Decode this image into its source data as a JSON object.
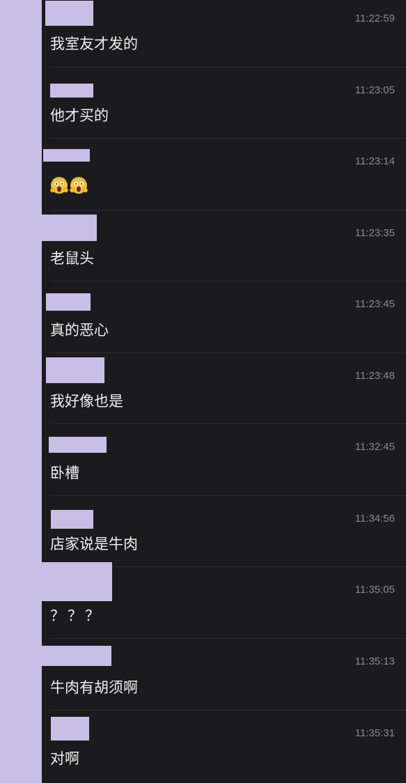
{
  "colors": {
    "background": "#1b1b1d",
    "redaction": "#c8bfe7",
    "text": "#f0f0f0",
    "timestamp": "#8a8a8f"
  },
  "messages": [
    {
      "time": "11:22:59",
      "text": "我室友才发的"
    },
    {
      "time": "11:23:05",
      "text": "他才买的"
    },
    {
      "time": "11:23:14",
      "text": "",
      "emoji": [
        "screaming-face-icon",
        "screaming-face-icon"
      ]
    },
    {
      "time": "11:23:35",
      "text": "老鼠头"
    },
    {
      "time": "11:23:45",
      "text": "真的恶心"
    },
    {
      "time": "11:23:48",
      "text": "我好像也是"
    },
    {
      "time": "11:32:45",
      "text": "卧槽"
    },
    {
      "time": "11:34:56",
      "text": "店家说是牛肉"
    },
    {
      "time": "11:35:05",
      "text": "？？？"
    },
    {
      "time": "11:35:13",
      "text": "牛肉有胡须啊"
    },
    {
      "time": "11:35:31",
      "text": "对啊"
    }
  ]
}
